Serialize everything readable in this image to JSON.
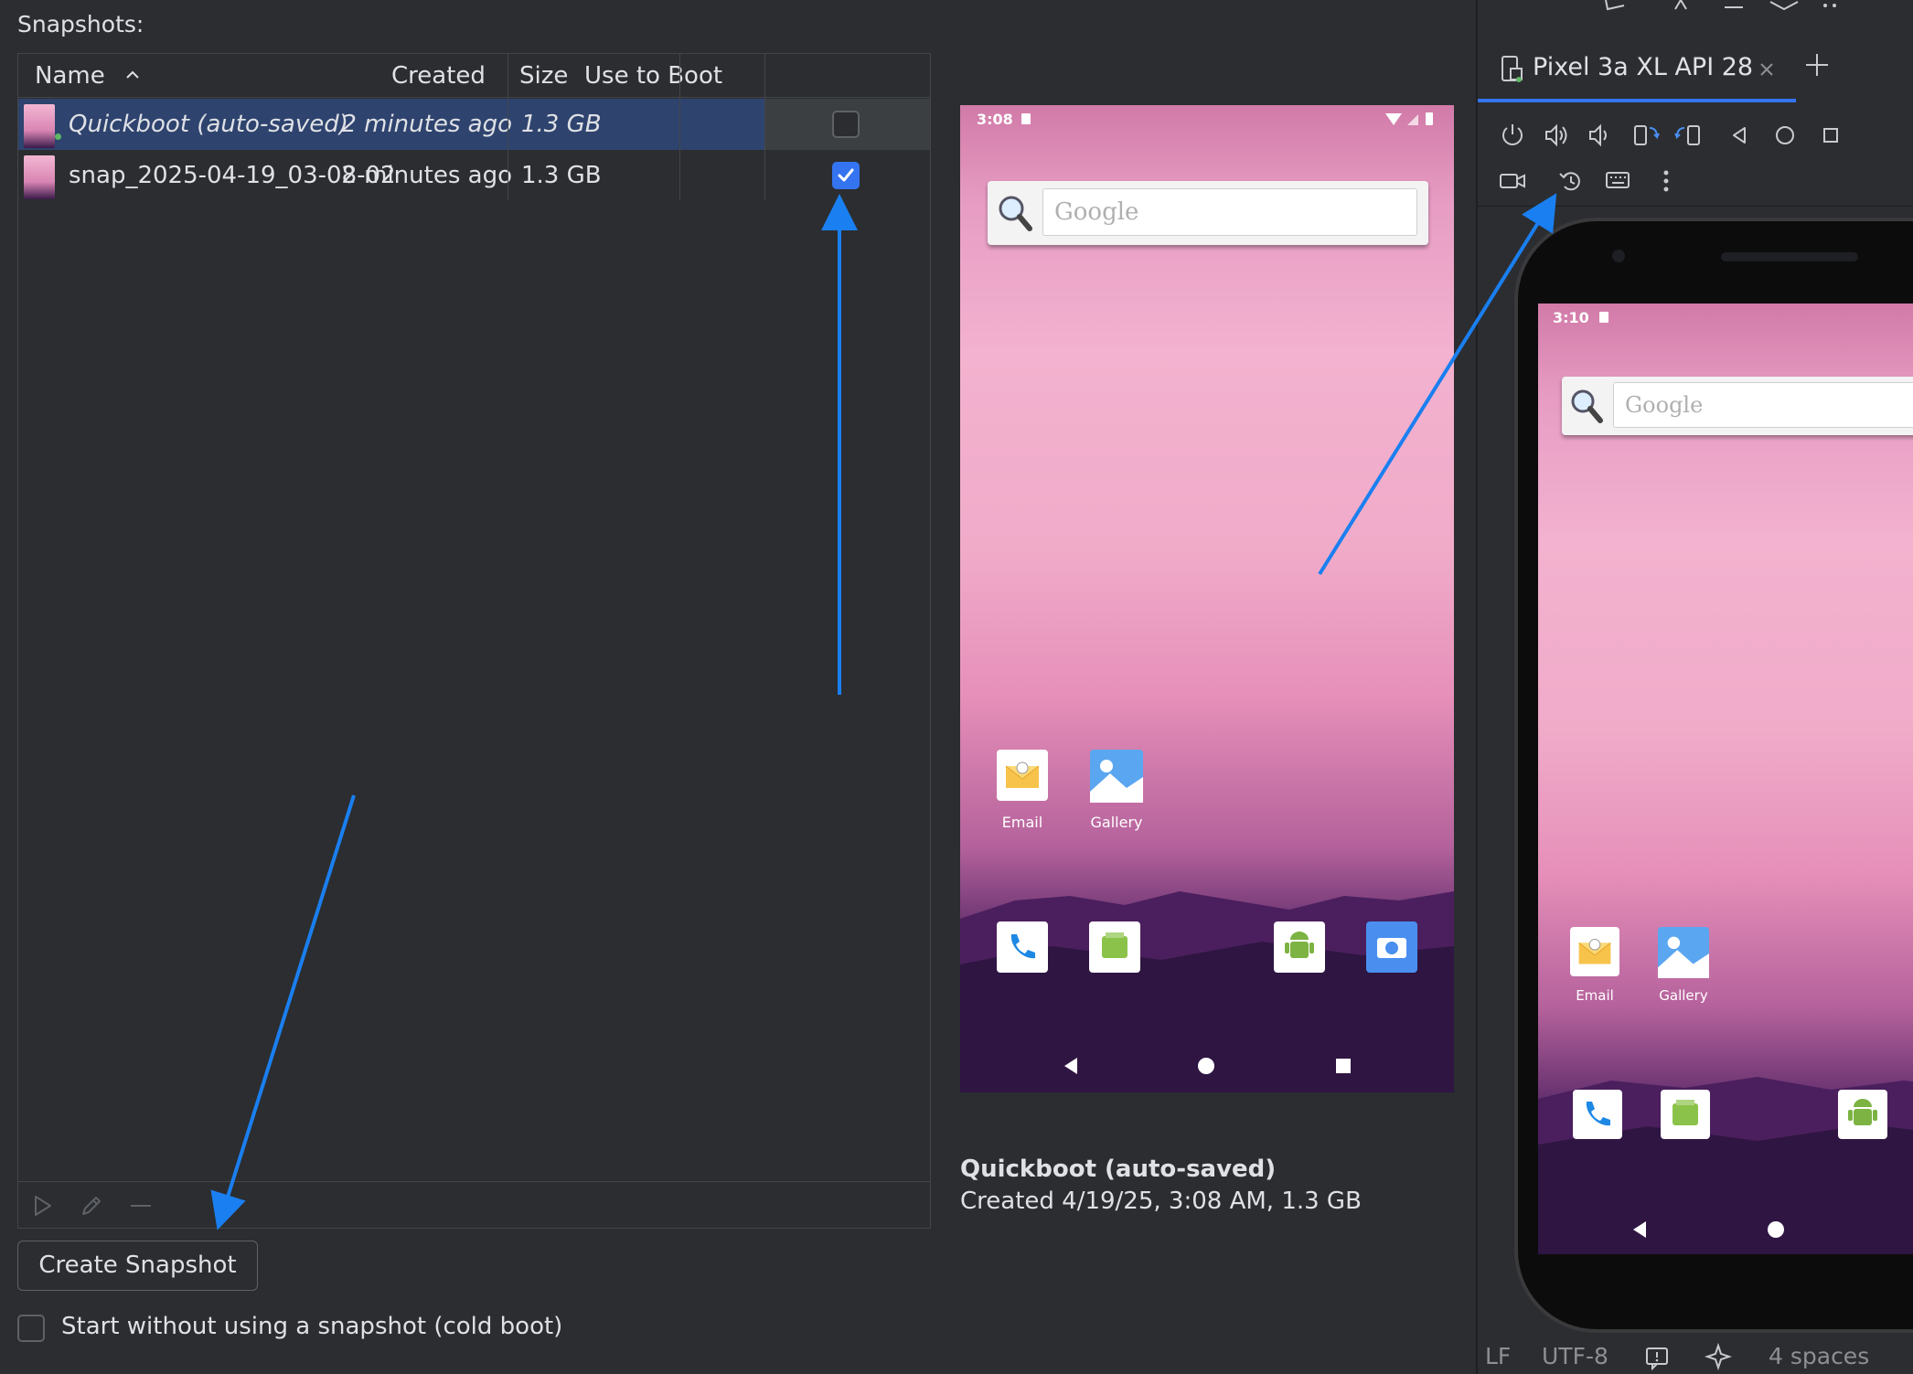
{
  "panel_title": "Snapshots:",
  "table": {
    "columns": {
      "name": "Name",
      "created": "Created",
      "size": "Size",
      "use_to_boot": "Use to Boot"
    },
    "rows": [
      {
        "name": "Quickboot (auto-saved)",
        "created": "2 minutes ago",
        "size": "1.3 GB",
        "use_to_boot": false,
        "selected": true
      },
      {
        "name": "snap_2025-04-19_03-08-02",
        "created": "2 minutes ago",
        "size": "1.3 GB",
        "use_to_boot": true,
        "selected": false
      }
    ],
    "toolbar_icons": [
      "play-icon",
      "pencil-icon",
      "minus-icon"
    ]
  },
  "create_snapshot_label": "Create Snapshot",
  "cold_boot": {
    "label": "Start without using a snapshot (cold boot)",
    "checked": false
  },
  "preview": {
    "time": "3:08",
    "search_placeholder": "Google",
    "apps_row1": [
      {
        "label": "Email",
        "icon": "email-icon"
      },
      {
        "label": "Gallery",
        "icon": "gallery-icon"
      }
    ],
    "dock_icons": [
      "phone-icon",
      "messaging-icon",
      "android-icon",
      "camera-icon"
    ],
    "name": "Quickboot (auto-saved)",
    "details": "Created 4/19/25, 3:08 AM, 1.3 GB"
  },
  "device_panel": {
    "tab_label": "Pixel 3a XL API 28",
    "toolbar_row1": [
      "power-icon",
      "volume-up-icon",
      "volume-down-icon",
      "rotate-left-icon",
      "rotate-right-icon",
      "back-icon",
      "home-icon",
      "overview-icon"
    ],
    "toolbar_row2": [
      "screen-record-icon",
      "snapshot-icon",
      "keyboard-icon",
      "more-icon"
    ],
    "phone": {
      "time": "3:10",
      "search_placeholder": "Google",
      "apps_row1": [
        {
          "label": "Email",
          "icon": "email-icon"
        },
        {
          "label": "Gallery",
          "icon": "gallery-icon"
        }
      ]
    }
  },
  "status_bar": {
    "line_ending": "LF",
    "encoding": "UTF-8",
    "indent": "4 spaces"
  },
  "colors": {
    "accent": "#3574f0",
    "annotation_arrow": "#1a7ff0",
    "selection": "#2e436e",
    "background": "#2b2d30"
  }
}
